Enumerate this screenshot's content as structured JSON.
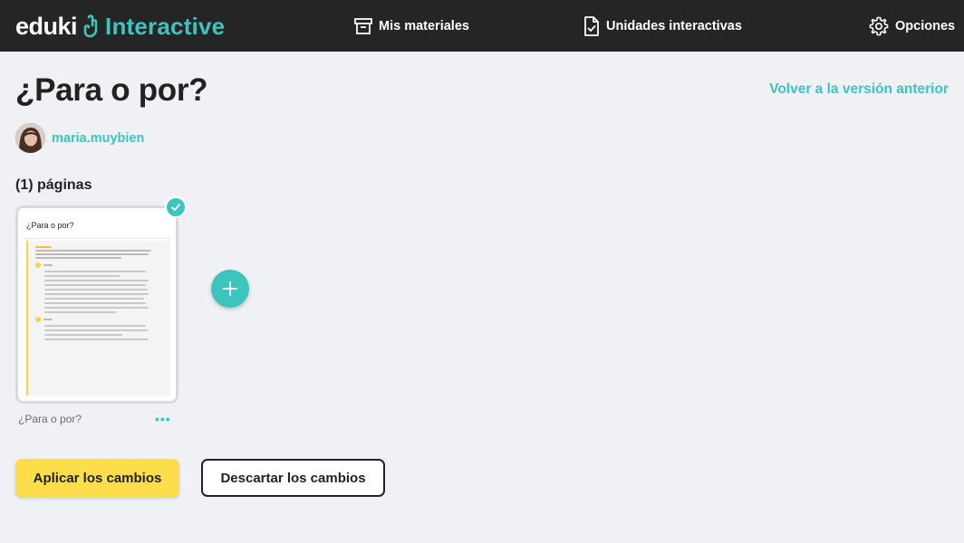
{
  "header": {
    "logo": {
      "brand": "eduki",
      "product": "Interactive"
    },
    "nav": {
      "materiales": "Mis materiales",
      "unidades": "Unidades interactivas",
      "opciones": "Opciones"
    }
  },
  "main": {
    "title": "¿Para o por?",
    "back_link": "Volver a la versión anterior",
    "author": "maria.muybien",
    "pages_count": "(1) páginas",
    "pages": [
      {
        "thumbnail_title": "¿Para o por?",
        "caption": "¿Para o por?",
        "selected": true
      }
    ],
    "menu_glyph": "•••"
  },
  "actions": {
    "apply": "Aplicar los cambios",
    "discard": "Descartar los cambios"
  },
  "colors": {
    "accent": "#3cc4bd",
    "topbar": "#252525",
    "apply_button": "#fbde4a",
    "background": "#f0f1f5"
  }
}
